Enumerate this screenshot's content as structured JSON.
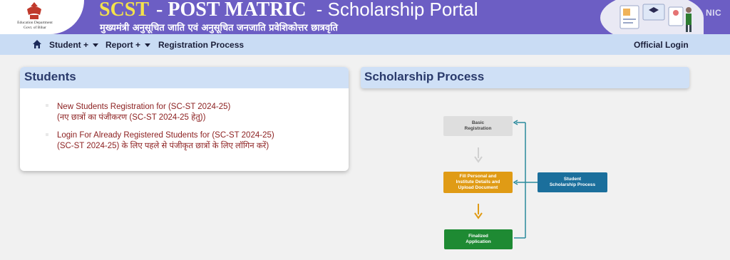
{
  "header": {
    "department_line1": "Education Department",
    "department_line2": "Govt. of Bihar",
    "title_scst": "SCST",
    "title_post": "- POST MATRIC",
    "title_portal": "- Scholarship Portal",
    "subtitle": "मुख्यमंत्री अनुसूचित जाति एवं अनुसूचित जनजाति  प्रवेशिकोत्तर छात्रवृति",
    "nic_logo_text": "NIC",
    "colors": {
      "banner": "#6c5ec4",
      "title_accent": "#f4e24a"
    }
  },
  "nav": {
    "home_icon": "home-icon",
    "items": [
      {
        "label": "Student +",
        "has_dropdown": true
      },
      {
        "label": "Report +",
        "has_dropdown": true
      },
      {
        "label": "Registration Process",
        "has_dropdown": false
      }
    ],
    "official_login": "Official Login"
  },
  "students_card": {
    "title": "Students",
    "links": [
      {
        "line1": "New Students Registration for (SC-ST 2024-25)",
        "line2": "(नए छात्रों का पंजीकरण (SC-ST 2024-25 हेतु))"
      },
      {
        "line1": "Login For Already Registered Students for (SC-ST 2024-25)",
        "line2": "(SC-ST 2024-25) के लिए पहले से पंजीकृत छात्रों के लिए लॉगिन करें)"
      }
    ]
  },
  "process": {
    "title": "Scholarship Process",
    "steps": {
      "basic_l1": "Basic",
      "basic_l2": "Registration",
      "fill_l1": "Fill Personal and",
      "fill_l2": "Institute Details and",
      "fill_l3": "Upload Document",
      "final_l1": "Finalized",
      "final_l2": "Application",
      "student_l1": "Student",
      "student_l2": "Scholarship Process"
    },
    "colors": {
      "step1": "#dedede",
      "step2": "#e09b15",
      "step3": "#1e8a33",
      "side": "#1b6f9c",
      "connector": "#2b8a9c"
    }
  }
}
